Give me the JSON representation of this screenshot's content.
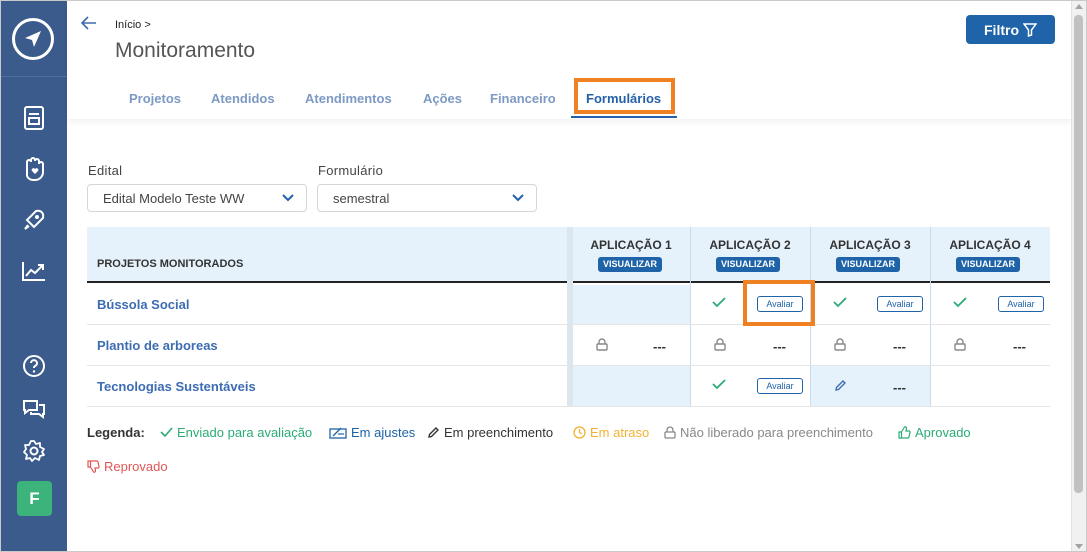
{
  "header": {
    "breadcrumb": "Início >",
    "title": "Monitoramento",
    "filter_label": "Filtro"
  },
  "tabs": [
    {
      "label": "Projetos"
    },
    {
      "label": "Atendidos"
    },
    {
      "label": "Atendimentos"
    },
    {
      "label": "Ações"
    },
    {
      "label": "Financeiro"
    },
    {
      "label": "Formulários",
      "active": true
    }
  ],
  "filters": {
    "edital_label": "Edital",
    "edital_value": "Edital Modelo Teste WW",
    "formulario_label": "Formulário",
    "formulario_value": "semestral"
  },
  "table": {
    "projects_header": "PROJETOS MONITORADOS",
    "applications": [
      {
        "name": "APLICAÇÃO 1",
        "action": "VISUALIZAR"
      },
      {
        "name": "APLICAÇÃO 2",
        "action": "VISUALIZAR"
      },
      {
        "name": "APLICAÇÃO 3",
        "action": "VISUALIZAR"
      },
      {
        "name": "APLICAÇÃO 4",
        "action": "VISUALIZAR"
      }
    ],
    "rows": [
      {
        "name": "Bússola Social",
        "cells": [
          {
            "status": ""
          },
          {
            "status": "enviado",
            "action": "Avaliar"
          },
          {
            "status": "enviado",
            "action": "Avaliar"
          },
          {
            "status": "enviado",
            "action": "Avaliar"
          }
        ]
      },
      {
        "name": "Plantio de arboreas",
        "cells": [
          {
            "status": "nao-liberado",
            "value": "---"
          },
          {
            "status": "nao-liberado",
            "value": "---"
          },
          {
            "status": "nao-liberado",
            "value": "---"
          },
          {
            "status": "nao-liberado",
            "value": "---"
          }
        ]
      },
      {
        "name": "Tecnologias Sustentáveis",
        "cells": [
          {
            "status": ""
          },
          {
            "status": "enviado",
            "action": "Avaliar"
          },
          {
            "status": "em-preenchimento",
            "value": "---"
          },
          {
            "status": ""
          }
        ]
      }
    ]
  },
  "legend": {
    "title": "Legenda:",
    "items": [
      {
        "icon": "check-icon",
        "label": "Enviado para avaliação",
        "color": "#2bac76"
      },
      {
        "icon": "adjust-icon",
        "label": "Em ajustes",
        "color": "#1f63a8"
      },
      {
        "icon": "pencil-icon",
        "label": "Em preenchimento",
        "color": "#333333"
      },
      {
        "icon": "clock-icon",
        "label": "Em atraso",
        "color": "#f2b231"
      },
      {
        "icon": "lock-icon",
        "label": "Não liberado para preenchimento",
        "color": "#888888"
      },
      {
        "icon": "thumbs-up-icon",
        "label": "Aprovado",
        "color": "#2bac76"
      },
      {
        "icon": "thumbs-down-icon",
        "label": "Reprovado",
        "color": "#e05656"
      }
    ]
  },
  "sidebar": {
    "items": [
      {
        "icon": "document-icon"
      },
      {
        "icon": "hand-heart-icon"
      },
      {
        "icon": "rocket-icon"
      },
      {
        "icon": "chart-icon"
      },
      {
        "icon": "help-icon"
      },
      {
        "icon": "chat-icon"
      },
      {
        "icon": "settings-icon"
      }
    ],
    "avatar_initial": "F"
  },
  "colors": {
    "sidebar": "#3a5b8c",
    "primary": "#1f63a8",
    "highlight": "#f08123",
    "success": "#2bac76"
  }
}
